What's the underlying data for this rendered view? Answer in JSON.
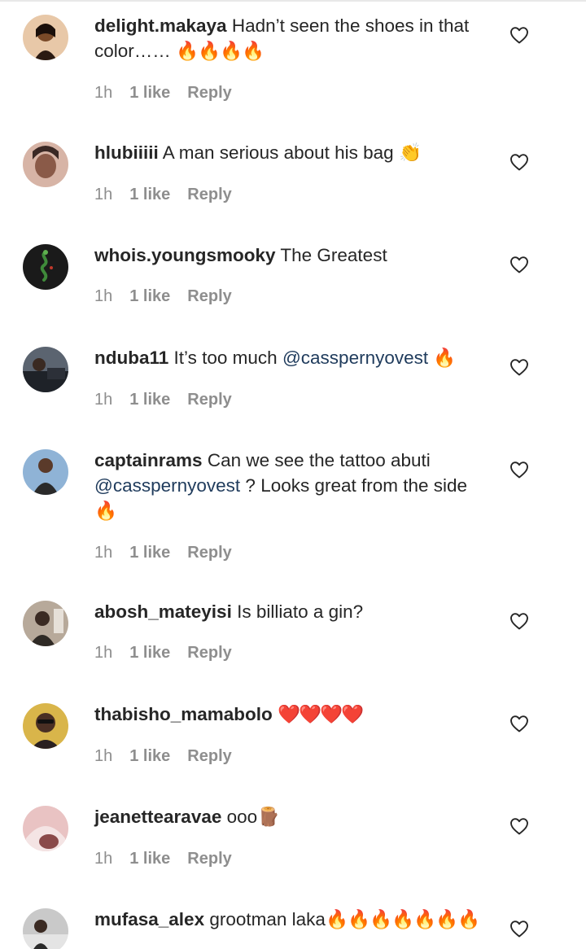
{
  "comments": [
    {
      "username": "delight.makaya",
      "text": "Hadn’t seen the shoes in that color…… ",
      "emoji": "🔥🔥🔥🔥",
      "time": "1h",
      "likes": "1 like",
      "reply": "Reply",
      "avatar_icon": "profile-photo",
      "avatar_colors": [
        "#c87a3a",
        "#2b1a12"
      ]
    },
    {
      "username": "hlubiiiii",
      "text": "A man serious about his bag ",
      "emoji": "👏",
      "time": "1h",
      "likes": "1 like",
      "reply": "Reply",
      "avatar_icon": "profile-photo",
      "avatar_colors": [
        "#d7b4a6",
        "#3a2824"
      ]
    },
    {
      "username": "whois.youngsmooky",
      "text": "The Greatest",
      "emoji": "",
      "time": "1h",
      "likes": "1 like",
      "reply": "Reply",
      "avatar_icon": "snake-logo",
      "avatar_colors": [
        "#1a1a1a",
        "#3f8a3a"
      ]
    },
    {
      "username": "nduba11",
      "text": "It’s too much ",
      "mention": "@casspernyovest",
      "text_after": " ",
      "emoji": "🔥",
      "time": "1h",
      "likes": "1 like",
      "reply": "Reply",
      "avatar_icon": "profile-photo",
      "avatar_colors": [
        "#5b6470",
        "#1e2228"
      ]
    },
    {
      "username": "captainrams",
      "text": "Can we see the tattoo abuti ",
      "mention": "@casspernyovest",
      "text_after": " ? Looks great from the side ",
      "emoji": "🔥",
      "time": "1h",
      "likes": "1 like",
      "reply": "Reply",
      "avatar_icon": "profile-photo",
      "avatar_colors": [
        "#8fb3d6",
        "#2a2a2a"
      ]
    },
    {
      "username": "abosh_mateyisi",
      "text": "Is billiato a gin?",
      "emoji": "",
      "time": "1h",
      "likes": "1 like",
      "reply": "Reply",
      "avatar_icon": "profile-photo",
      "avatar_colors": [
        "#b7a99a",
        "#2f2a25"
      ]
    },
    {
      "username": "thabisho_mamabolo",
      "text": "",
      "emoji": "❤️❤️❤️❤️",
      "time": "1h",
      "likes": "1 like",
      "reply": "Reply",
      "avatar_icon": "profile-photo",
      "avatar_colors": [
        "#d9b54a",
        "#2a2020"
      ]
    },
    {
      "username": "jeanettearavae",
      "text": "ooo",
      "emoji": "🪵",
      "time": "1h",
      "likes": "1 like",
      "reply": "Reply",
      "avatar_icon": "profile-photo",
      "avatar_colors": [
        "#e9c3c3",
        "#8a4a4a"
      ]
    },
    {
      "username": "mufasa_alex",
      "text": "grootman laka",
      "emoji": "🔥🔥🔥🔥🔥🔥🔥",
      "time": "",
      "likes": "",
      "reply": "",
      "avatar_icon": "profile-photo",
      "avatar_colors": [
        "#c9c9c9",
        "#2a2a2a"
      ]
    }
  ],
  "icons": {
    "like": "heart-outline-icon"
  },
  "colors": {
    "username": "#262626",
    "meta": "#8e8e8e",
    "mention": "#1f3b5c",
    "fire": "#ff5a12",
    "heart": "#e5102b"
  }
}
